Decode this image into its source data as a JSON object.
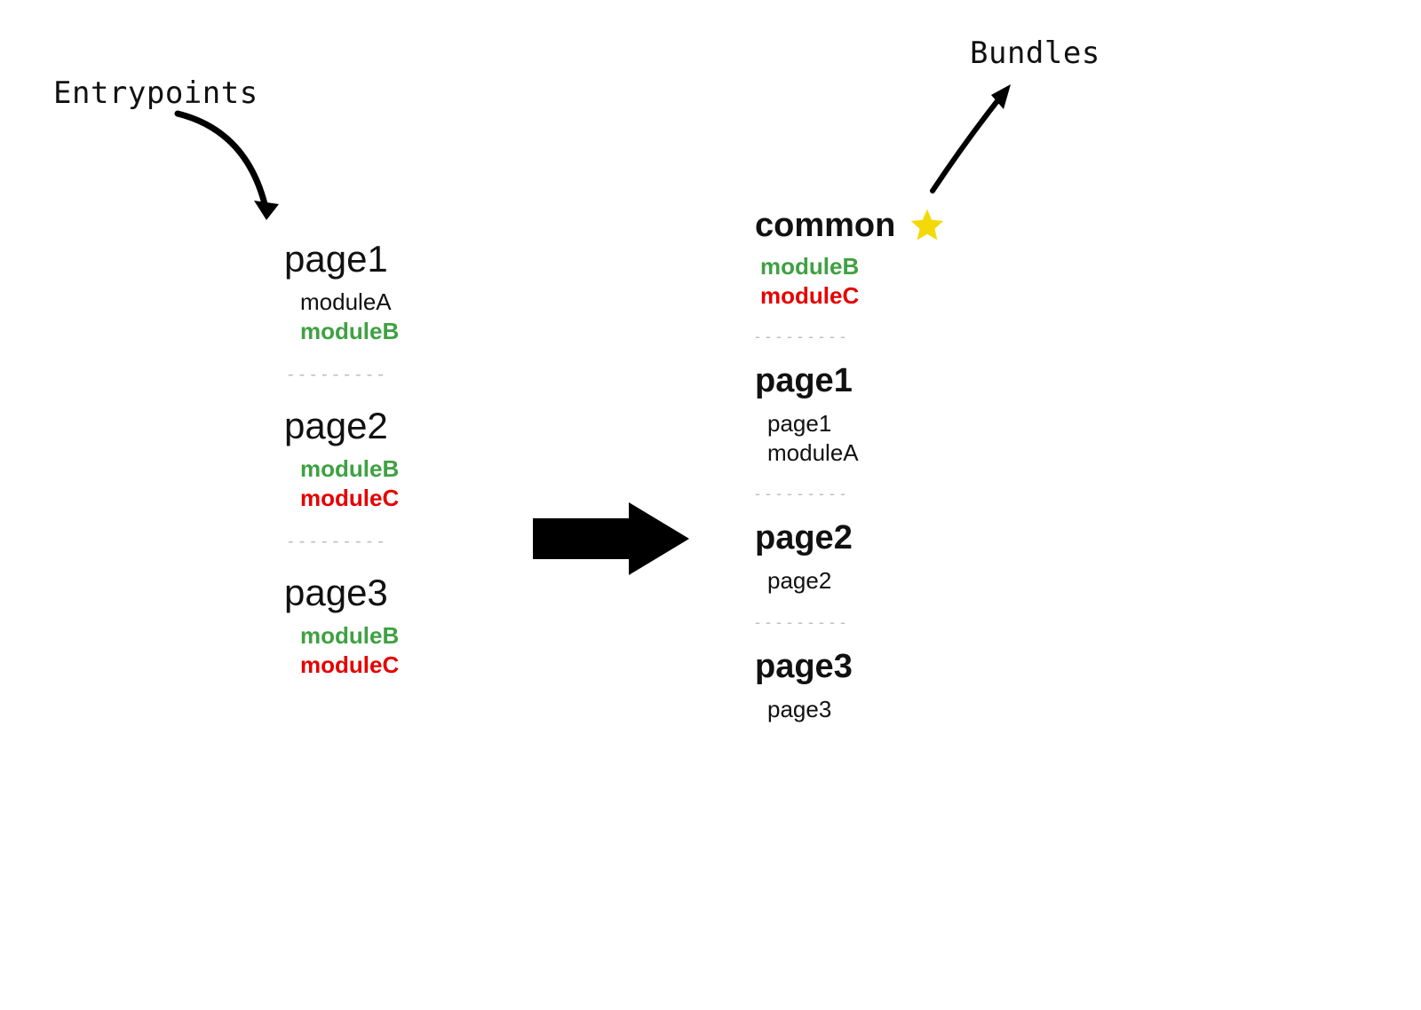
{
  "labels": {
    "entrypoints": "Entrypoints",
    "bundles": "Bundles"
  },
  "colors": {
    "green": "#3fa142",
    "red": "#e60000",
    "divider": "#bfbfbf",
    "star": "#f4d909"
  },
  "left": {
    "groups": [
      {
        "title": "page1",
        "items": [
          {
            "text": "moduleA",
            "color": "black",
            "bold": false
          },
          {
            "text": "moduleB",
            "color": "green",
            "bold": true
          }
        ]
      },
      {
        "title": "page2",
        "items": [
          {
            "text": "moduleB",
            "color": "green",
            "bold": true
          },
          {
            "text": "moduleC",
            "color": "red",
            "bold": true
          }
        ]
      },
      {
        "title": "page3",
        "items": [
          {
            "text": "moduleB",
            "color": "green",
            "bold": true
          },
          {
            "text": "moduleC",
            "color": "red",
            "bold": true
          }
        ]
      }
    ]
  },
  "right": {
    "groups": [
      {
        "title": "common",
        "starred": true,
        "items": [
          {
            "text": "moduleB",
            "color": "green",
            "bold": true
          },
          {
            "text": "moduleC",
            "color": "red",
            "bold": true
          }
        ]
      },
      {
        "title": "page1",
        "starred": false,
        "items": [
          {
            "text": "page1",
            "color": "black",
            "bold": false
          },
          {
            "text": "moduleA",
            "color": "black",
            "bold": false
          }
        ]
      },
      {
        "title": "page2",
        "starred": false,
        "items": [
          {
            "text": "page2",
            "color": "black",
            "bold": false
          }
        ]
      },
      {
        "title": "page3",
        "starred": false,
        "items": [
          {
            "text": "page3",
            "color": "black",
            "bold": false
          }
        ]
      }
    ]
  }
}
